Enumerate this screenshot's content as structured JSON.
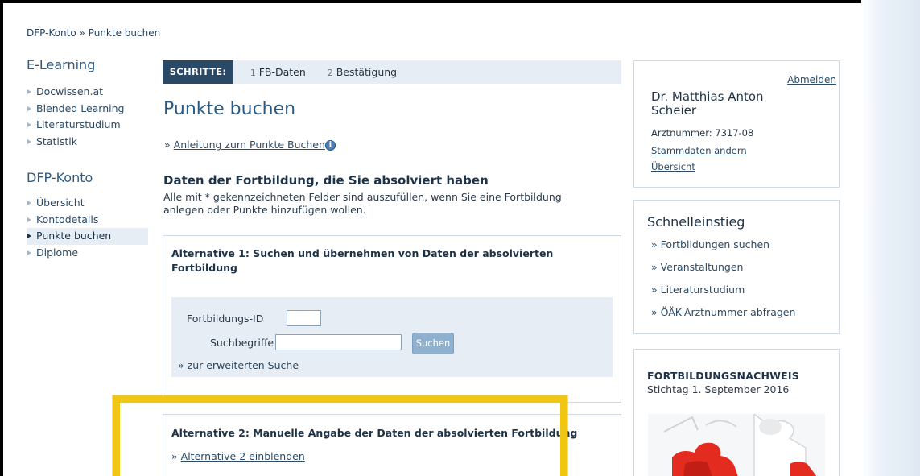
{
  "breadcrumb": "DFP-Konto » Punkte buchen",
  "nav": {
    "elearning_heading": "E-Learning",
    "elearning_items": [
      "Docwissen.at",
      "Blended Learning",
      "Literaturstudium",
      "Statistik"
    ],
    "dfp_heading": "DFP-Konto",
    "dfp_items": [
      "Übersicht",
      "Kontodetails",
      "Punkte buchen",
      "Diplome"
    ],
    "active_item": "Punkte buchen"
  },
  "steps": {
    "label": "SCHRITTE:",
    "items": [
      {
        "num": "1",
        "label": "FB-Daten",
        "current": true
      },
      {
        "num": "2",
        "label": "Bestätigung",
        "current": false
      }
    ]
  },
  "main": {
    "title": "Punkte buchen",
    "guide_prefix": "»",
    "guide_link": "Anleitung zum Punkte Buchen",
    "info_icon": "i",
    "section_heading": "Daten der Fortbildung, die Sie absolviert haben",
    "section_note": "Alle mit * gekennzeichneten Felder sind auszufüllen, wenn Sie eine Fortbildung anlegen oder Punkte hinzufügen wollen.",
    "alt1": {
      "title": "Alternative 1: Suchen und übernehmen von Daten der absolvierten Fortbildung",
      "id_label": "Fortbildungs-ID",
      "id_value": "",
      "terms_label": "Suchbegriffe",
      "terms_value": "",
      "search_button": "Suchen",
      "advanced_prefix": "»",
      "advanced_link": "zur erweiterten Suche"
    },
    "alt2": {
      "title": "Alternative 2: Manuelle Angabe der Daten der absolvierten Fortbildung",
      "show_prefix": "»",
      "show_link": "Alternative 2 einblenden"
    }
  },
  "user": {
    "logout": "Abmelden",
    "name": "Dr. Matthias Anton Scheier",
    "number": "Arztnummer: 7317-08",
    "links": [
      "Stammdaten ändern",
      "Übersicht"
    ]
  },
  "quick": {
    "title": "Schnelleinstieg",
    "items": [
      "» Fortbildungen suchen",
      "» Veranstaltungen",
      "» Literaturstudium",
      "» ÖÄK-Arztnummer abfragen"
    ]
  },
  "certificate": {
    "title": "FORTBILDUNGSNACHWEIS",
    "date": "Stichtag 1. September 2016"
  },
  "colors": {
    "accent": "#2b5b84",
    "steps_label_bg": "#2a4967",
    "panel_bg": "#e6edf4",
    "button": "#8fb0cf",
    "highlight": "#f0c514",
    "puzzle_red": "#e32b1f"
  }
}
